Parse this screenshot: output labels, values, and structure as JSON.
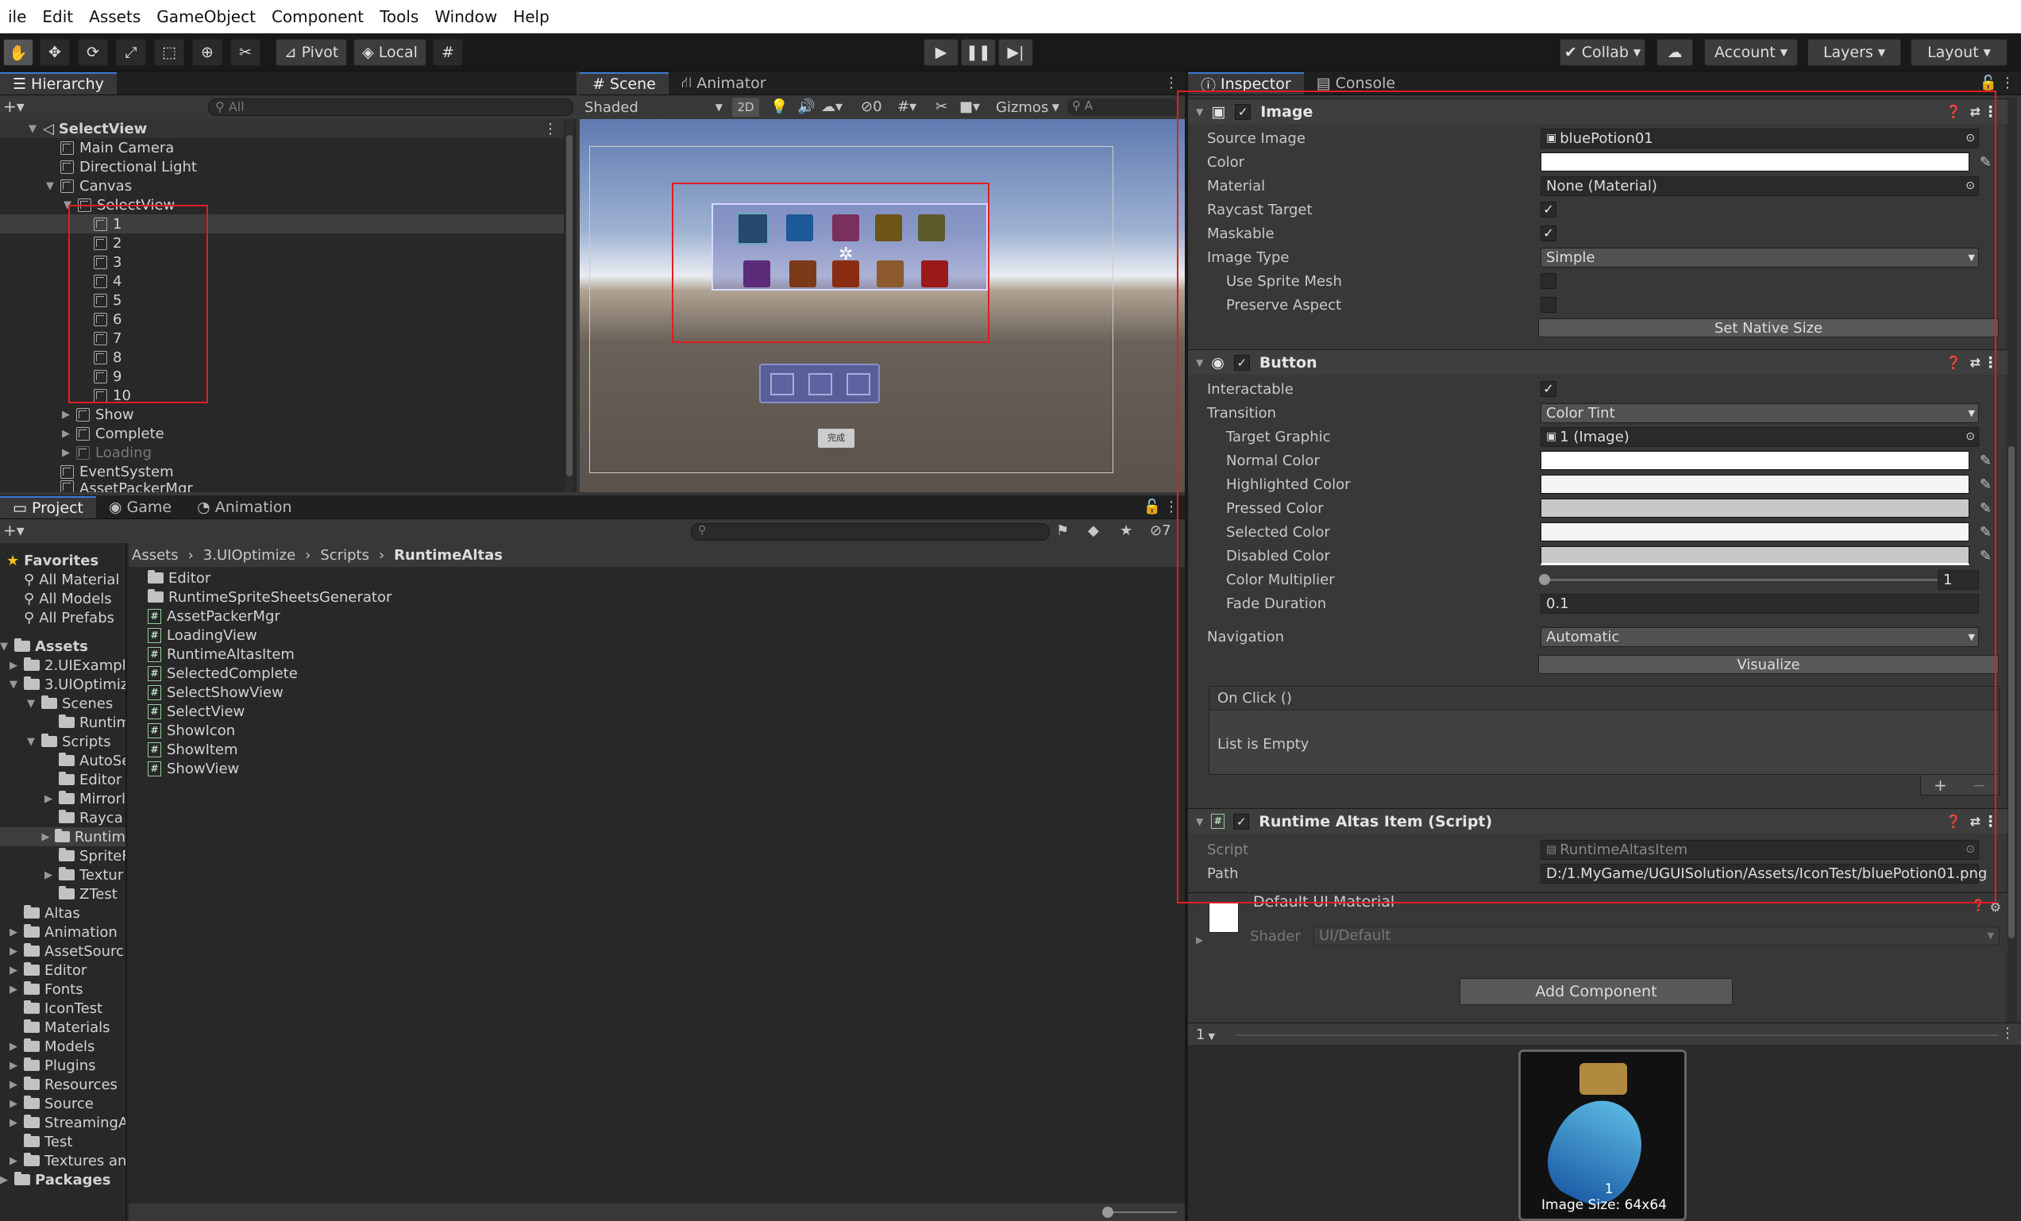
{
  "menubar": {
    "items": [
      "ile",
      "Edit",
      "Assets",
      "GameObject",
      "Component",
      "Tools",
      "Window",
      "Help"
    ]
  },
  "toolbar": {
    "pivot": "Pivot",
    "local": "Local",
    "collab": "Collab",
    "account": "Account",
    "layers": "Layers",
    "layout": "Layout"
  },
  "hierarchy": {
    "tab": "Hierarchy",
    "search_placeholder": "All",
    "items": [
      {
        "label": "SelectView"
      },
      {
        "label": "Main Camera"
      },
      {
        "label": "Directional Light"
      },
      {
        "label": "Canvas"
      },
      {
        "label": "SelectView"
      },
      {
        "label": "1"
      },
      {
        "label": "2"
      },
      {
        "label": "3"
      },
      {
        "label": "4"
      },
      {
        "label": "5"
      },
      {
        "label": "6"
      },
      {
        "label": "7"
      },
      {
        "label": "8"
      },
      {
        "label": "9"
      },
      {
        "label": "10"
      },
      {
        "label": "Show"
      },
      {
        "label": "Complete"
      },
      {
        "label": "Loading"
      },
      {
        "label": "EventSystem"
      },
      {
        "label": "AssetPackerMgr"
      }
    ]
  },
  "scene": {
    "tab_scene": "Scene",
    "tab_animator": "Animator",
    "shading": "Shaded",
    "mode_2d": "2D",
    "gizmos": "Gizmos",
    "hidden_count": "0",
    "complete_btn": "完成"
  },
  "project": {
    "tab_project": "Project",
    "tab_game": "Game",
    "tab_animation": "Animation",
    "hidden_count": "7",
    "breadcrumb": [
      "Assets",
      "3.UIOptimize",
      "Scripts",
      "RuntimeAltas"
    ],
    "favorites": {
      "title": "Favorites",
      "items": [
        "All Material",
        "All Models",
        "All Prefabs"
      ]
    },
    "tree": [
      {
        "label": "Assets"
      },
      {
        "label": "2.UIExampl"
      },
      {
        "label": "3.UIOptimiz"
      },
      {
        "label": "Scenes"
      },
      {
        "label": "Runtim"
      },
      {
        "label": "Scripts"
      },
      {
        "label": "AutoSe"
      },
      {
        "label": "Editor"
      },
      {
        "label": "Mirrorl"
      },
      {
        "label": "Rayca"
      },
      {
        "label": "Runtim"
      },
      {
        "label": "SpriteF"
      },
      {
        "label": "Textur"
      },
      {
        "label": "ZTest"
      },
      {
        "label": "Altas"
      },
      {
        "label": "Animation"
      },
      {
        "label": "AssetSourc"
      },
      {
        "label": "Editor"
      },
      {
        "label": "Fonts"
      },
      {
        "label": "IconTest"
      },
      {
        "label": "Materials"
      },
      {
        "label": "Models"
      },
      {
        "label": "Plugins"
      },
      {
        "label": "Resources"
      },
      {
        "label": "Source"
      },
      {
        "label": "StreamingA"
      },
      {
        "label": "Test"
      },
      {
        "label": "Textures an"
      },
      {
        "label": "Packages"
      }
    ],
    "files": [
      {
        "label": "Editor",
        "type": "folder"
      },
      {
        "label": "RuntimeSpriteSheetsGenerator",
        "type": "folder"
      },
      {
        "label": "AssetPackerMgr",
        "type": "script"
      },
      {
        "label": "LoadingView",
        "type": "script"
      },
      {
        "label": "RuntimeAltasItem",
        "type": "script"
      },
      {
        "label": "SelectedComplete",
        "type": "script"
      },
      {
        "label": "SelectShowView",
        "type": "script"
      },
      {
        "label": "SelectView",
        "type": "script"
      },
      {
        "label": "ShowIcon",
        "type": "script"
      },
      {
        "label": "ShowItem",
        "type": "script"
      },
      {
        "label": "ShowView",
        "type": "script"
      }
    ]
  },
  "inspector": {
    "tab_inspector": "Inspector",
    "tab_console": "Console",
    "image": {
      "title": "Image",
      "source_image_label": "Source Image",
      "source_image": "bluePotion01",
      "color_label": "Color",
      "material_label": "Material",
      "material": "None (Material)",
      "raycast_label": "Raycast Target",
      "maskable_label": "Maskable",
      "image_type_label": "Image Type",
      "image_type": "Simple",
      "use_sprite_mesh_label": "Use Sprite Mesh",
      "preserve_aspect_label": "Preserve Aspect",
      "set_native_size": "Set Native Size"
    },
    "button": {
      "title": "Button",
      "interactable_label": "Interactable",
      "transition_label": "Transition",
      "transition": "Color Tint",
      "target_graphic_label": "Target Graphic",
      "target_graphic": "1 (Image)",
      "normal_label": "Normal Color",
      "highlighted_label": "Highlighted Color",
      "pressed_label": "Pressed Color",
      "selected_label": "Selected Color",
      "disabled_label": "Disabled Color",
      "multiplier_label": "Color Multiplier",
      "multiplier": "1",
      "fade_label": "Fade Duration",
      "fade": "0.1",
      "navigation_label": "Navigation",
      "navigation": "Automatic",
      "visualize": "Visualize",
      "onclick": "On Click ()",
      "list_empty": "List is Empty"
    },
    "script": {
      "title": "Runtime Altas Item (Script)",
      "script_label": "Script",
      "script_value": "RuntimeAltasItem",
      "path_label": "Path",
      "path_value": "D:/1.MyGame/UGUISolution/Assets/IconTest/bluePotion01.png"
    },
    "material": {
      "title": "Default UI Material",
      "shader_label": "Shader",
      "shader": "UI/Default"
    },
    "add_component": "Add Component",
    "preview": {
      "dropdown": "1",
      "name": "1",
      "size": "Image Size: 64x64"
    }
  },
  "colors": {
    "highlight_red": "#e21d24",
    "accent": "#3a7bd5"
  }
}
